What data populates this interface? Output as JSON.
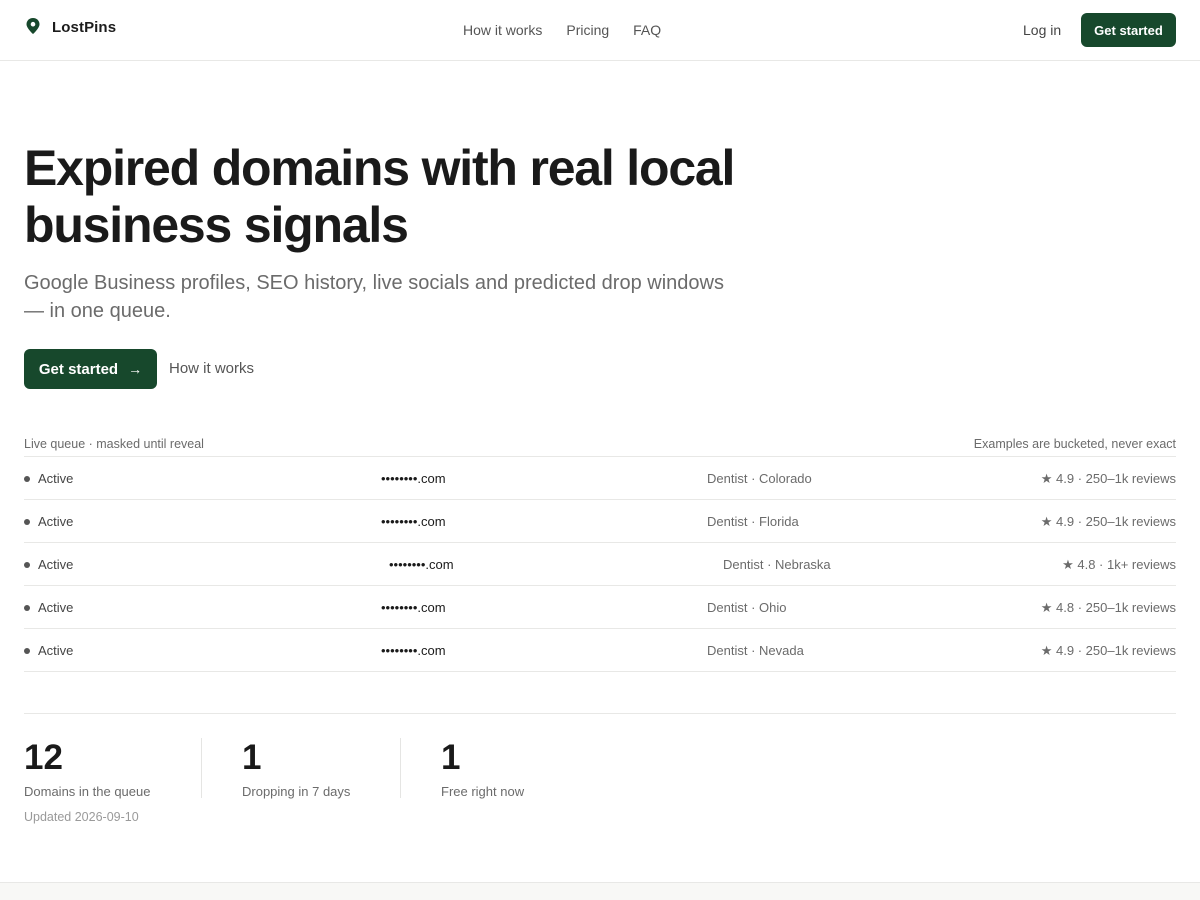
{
  "header": {
    "brand": "LostPins",
    "nav": [
      "How it works",
      "Pricing",
      "FAQ"
    ],
    "login": "Log in",
    "cta": "Get started"
  },
  "hero": {
    "title": "Expired domains with real local business signals",
    "subtitle": "Google Business profiles, SEO history, live socials and predicted drop windows — in one queue.",
    "cta": "Get started",
    "cta_icon": "arrow-right-icon",
    "secondary": "How it works"
  },
  "queue": {
    "left_caption": "Live queue · masked until reveal",
    "right_caption": "Examples are bucketed, never exact",
    "rows": [
      {
        "status": "Active",
        "domain": "••••••••.com",
        "category": "Dentist · Colorado",
        "rating": "★ 4.9 · 250–1k reviews"
      },
      {
        "status": "Active",
        "domain": "••••••••.com",
        "category": "Dentist · Florida",
        "rating": "★ 4.9 · 250–1k reviews"
      },
      {
        "status": "Active",
        "domain": "••••••••.com",
        "category": "Dentist · Nebraska",
        "rating": "★ 4.8 · 1k+ reviews"
      },
      {
        "status": "Active",
        "domain": "••••••••.com",
        "category": "Dentist · Ohio",
        "rating": "★ 4.8 · 250–1k reviews"
      },
      {
        "status": "Active",
        "domain": "••••••••.com",
        "category": "Dentist · Nevada",
        "rating": "★ 4.9 · 250–1k reviews"
      }
    ]
  },
  "stats": [
    {
      "value": "12",
      "label": "Domains in the queue"
    },
    {
      "value": "1",
      "label": "Dropping in 7 days"
    },
    {
      "value": "1",
      "label": "Free right now"
    }
  ],
  "updated": "Updated 2026-09-10",
  "colors": {
    "accent": "#17482c",
    "text": "#1a1a1a",
    "muted": "#6b6b6b"
  }
}
